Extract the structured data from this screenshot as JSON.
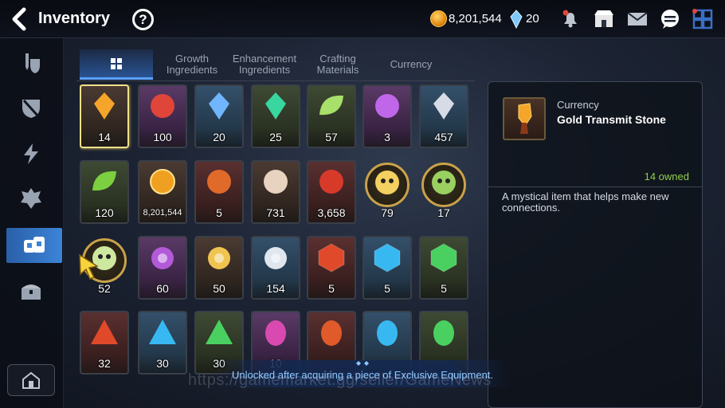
{
  "header": {
    "title": "Inventory",
    "help_label": "?",
    "gold": "8,201,544",
    "crystals": "20"
  },
  "tabs": [
    {
      "label": "",
      "icon": "grid-icon",
      "active": true
    },
    {
      "label": "Growth Ingredients"
    },
    {
      "label": "Enhancement Ingredients"
    },
    {
      "label": "Crafting Materials"
    },
    {
      "label": "Currency"
    }
  ],
  "items": [
    {
      "count": "14",
      "icon": "gold-transmit-stone-icon",
      "selected": true
    },
    {
      "count": "100",
      "icon": "red-rune-icon"
    },
    {
      "count": "20",
      "icon": "blue-crystal-icon"
    },
    {
      "count": "25",
      "icon": "green-gem-icon"
    },
    {
      "count": "57",
      "icon": "leaf-icon"
    },
    {
      "count": "3",
      "icon": "purple-seal-icon"
    },
    {
      "count": "457",
      "icon": "silver-shard-icon"
    },
    {
      "count": "120",
      "icon": "heart-leaf-icon"
    },
    {
      "count": "8,201,544",
      "icon": "gold-coin-icon"
    },
    {
      "count": "5",
      "icon": "banner-icon"
    },
    {
      "count": "731",
      "icon": "chess-knight-icon"
    },
    {
      "count": "3,658",
      "icon": "red-mask-icon"
    },
    {
      "count": "79",
      "icon": "penguin-gold-icon"
    },
    {
      "count": "17",
      "icon": "penguin-green-icon"
    },
    {
      "count": "52",
      "icon": "penguin-white-icon"
    },
    {
      "count": "60",
      "icon": "purple-flower-icon"
    },
    {
      "count": "50",
      "icon": "gold-flower-icon"
    },
    {
      "count": "154",
      "icon": "silver-flower-icon"
    },
    {
      "count": "5",
      "icon": "red-hex-icon"
    },
    {
      "count": "5",
      "icon": "blue-hex-icon"
    },
    {
      "count": "5",
      "icon": "green-hex-icon"
    },
    {
      "count": "32",
      "icon": "red-triangle-icon"
    },
    {
      "count": "30",
      "icon": "blue-triangle-icon"
    },
    {
      "count": "30",
      "icon": "green-triangle-icon"
    },
    {
      "count": "10",
      "icon": "pink-oval-icon"
    },
    {
      "count": "",
      "icon": "red-oval-icon"
    },
    {
      "count": "",
      "icon": "blue-oval-icon"
    },
    {
      "count": "",
      "icon": "green-oval-icon"
    }
  ],
  "detail": {
    "category": "Currency",
    "name": "Gold Transmit Stone",
    "owned": "14 owned",
    "description": "A mystical item that helps make new connections."
  },
  "banner": "Unlocked after acquiring a piece of Exclusive Equipment.",
  "watermark": "https://gamemarket.gg/seller/GameNews",
  "colors": {
    "accent": "#3c84d8",
    "owned": "#8fcf4a",
    "banner_text": "#8ec8ff",
    "selected_border": "#f2e08a"
  }
}
